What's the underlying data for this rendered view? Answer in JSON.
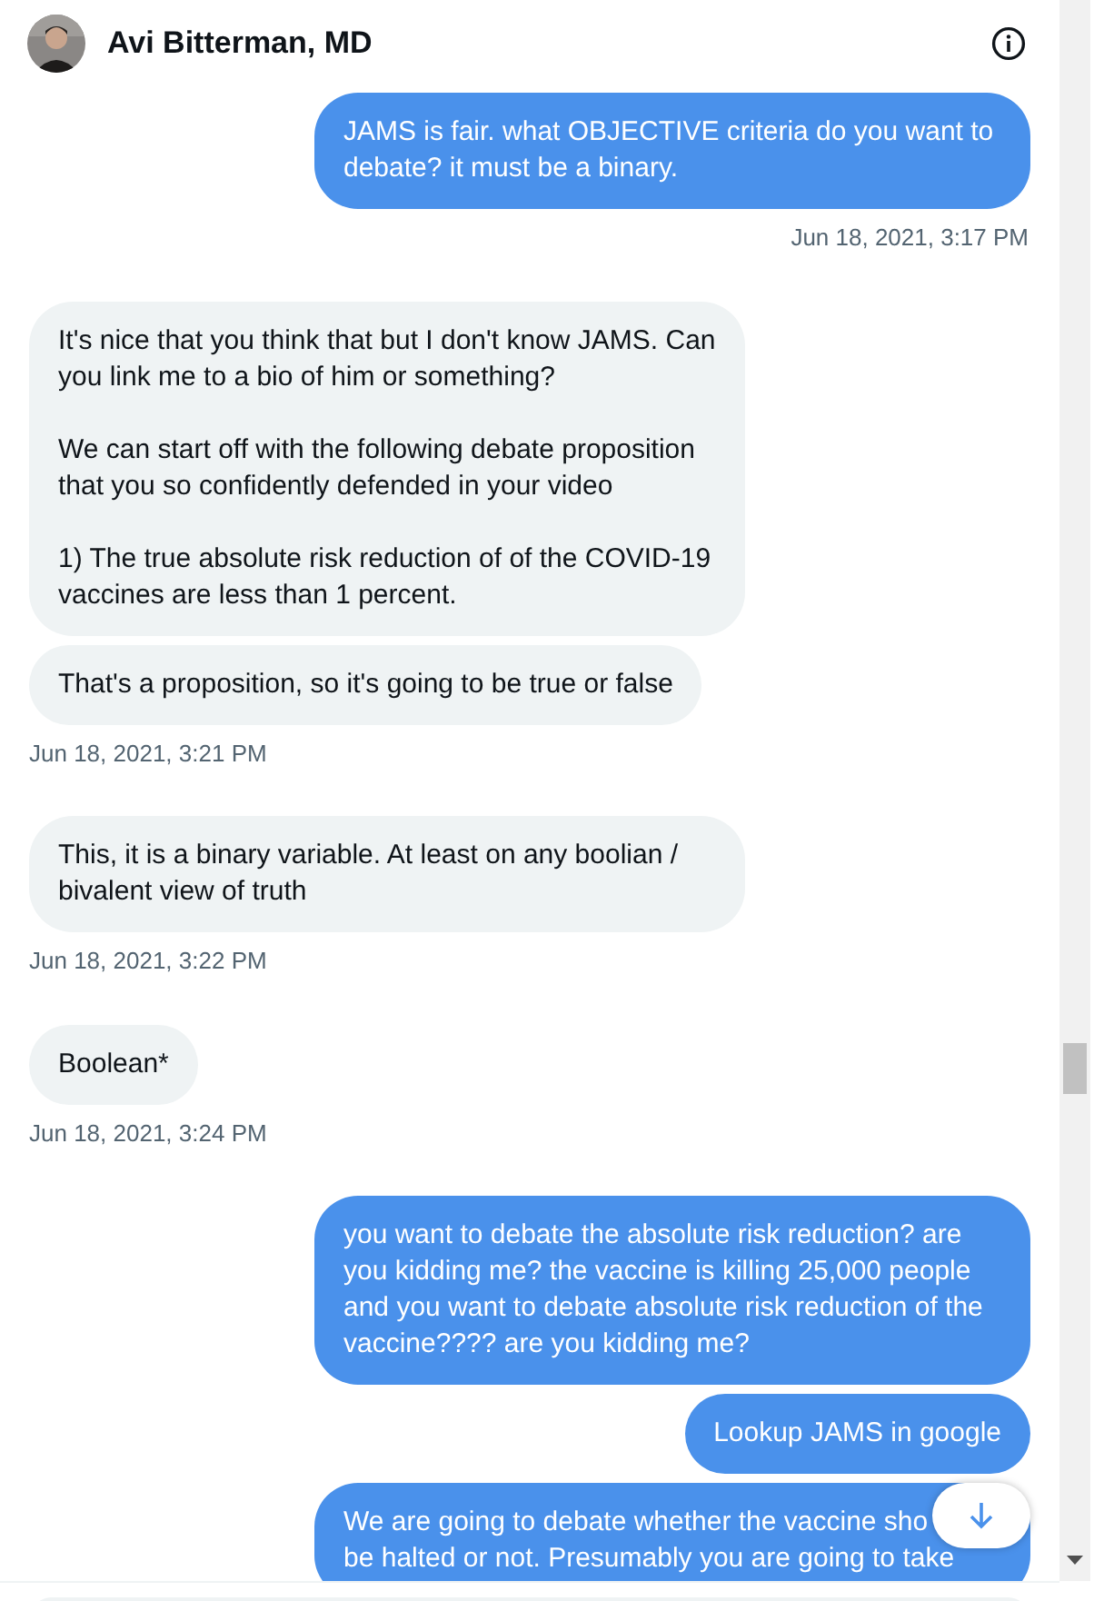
{
  "header": {
    "title": "Avi Bitterman, MD"
  },
  "messages": [
    {
      "kind": "sent",
      "text": "JAMS is fair. what OBJECTIVE criteria do you want to debate? it must be a binary.",
      "timestamp": "Jun 18, 2021, 3:17 PM"
    },
    {
      "kind": "received",
      "text": "It's nice that you think that but I don't know JAMS. Can you link me to a bio of him or something?\n\nWe can start off with the following debate proposition that you so confidently defended in your video\n\n1) The true absolute risk reduction of  of the COVID-19 vaccines are less than 1 percent."
    },
    {
      "kind": "received",
      "text": "That's a proposition, so it's going to be true or false",
      "timestamp": "Jun 18, 2021, 3:21 PM"
    },
    {
      "kind": "received",
      "text": "This, it is a binary variable. At least on any boolian / bivalent view of truth",
      "timestamp": "Jun 18, 2021, 3:22 PM"
    },
    {
      "kind": "received",
      "text": "Boolean*",
      "timestamp": "Jun 18, 2021, 3:24 PM"
    },
    {
      "kind": "sent",
      "text": "you want to debate the absolute risk reduction? are you kidding me? the vaccine is killing 25,000 people and you want to debate absolute risk reduction of the vaccine???? are you kidding me?"
    },
    {
      "kind": "sent",
      "text": "Lookup JAMS in google"
    },
    {
      "kind": "sent",
      "lines": [
        "We are going to debate whether the vaccine sho",
        "be halted or not. Presumably you are going to take"
      ]
    }
  ]
}
